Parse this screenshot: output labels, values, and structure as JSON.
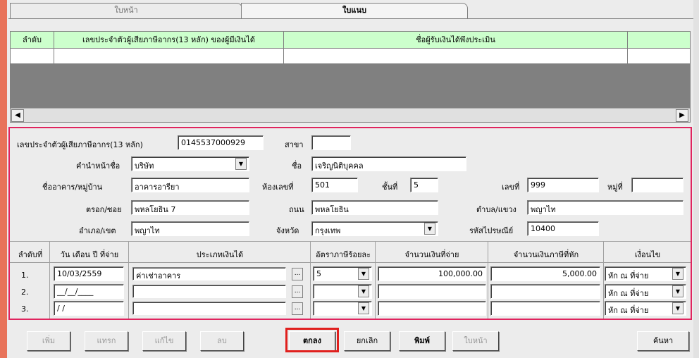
{
  "tabs": {
    "front": "ใบหน้า",
    "form": "ใบแนบ"
  },
  "grid": {
    "headers": [
      "ลำดับ",
      "เลขประจำตัวผู้เสียภาษีอากร(13 หลัก) ของผู้มีเงินได้",
      "ชื่อผู้รับเงินได้พึงประเมิน"
    ],
    "scroll_left": "◀",
    "scroll_right": "▶"
  },
  "form": {
    "taxid_label": "เลขประจำตัวผู้เสียภาษีอากร(13 หลัก)",
    "taxid_value": "0145537000929",
    "branch_label": "สาขา",
    "branch_value": "",
    "prefix_label": "คำนำหน้าชื่อ",
    "prefix_value": "บริษัท",
    "name_label": "ชื่อ",
    "name_value": "เจริญนิติบุคคล",
    "building_label": "ชื่ออาคาร/หมู่บ้าน",
    "building_value": "อาคารอารียา",
    "room_label": "ห้องเลขที่",
    "room_value": "501",
    "floor_label": "ชั้นที่",
    "floor_value": "5",
    "houseno_label": "เลขที่",
    "houseno_value": "999",
    "moo_label": "หมู่ที่",
    "moo_value": "",
    "soi_label": "ตรอก/ซอย",
    "soi_value": "พหลโยธิน 7",
    "road_label": "ถนน",
    "road_value": "พหลโยธิน",
    "subdistrict_label": "ตำบล/แขวง",
    "subdistrict_value": "พญาไท",
    "district_label": "อำเภอ/เขต",
    "district_value": "พญาไท",
    "province_label": "จังหวัด",
    "province_value": "กรุงเทพ",
    "postcode_label": "รหัสไปรษณีย์",
    "postcode_value": "10400"
  },
  "items": {
    "headers": {
      "no": "ลำดับที่",
      "date": "วัน เดือน ปี ที่จ่าย",
      "type": "ประเภทเงินได้",
      "rate": "อัตราภาษีร้อยละ",
      "paid": "จำนวนเงินที่จ่าย",
      "tax": "จำนวนเงินภาษีที่หัก",
      "cond": "เงื่อนไข"
    },
    "rows": [
      {
        "no": "1.",
        "date": "10/03/2559",
        "type": "ค่าเช่าอาคาร",
        "rate": "5",
        "paid": "100,000.00",
        "tax": "5,000.00",
        "cond": "หัก ณ ที่จ่าย"
      },
      {
        "no": "2.",
        "date": "__/__/____",
        "type": "",
        "rate": "",
        "paid": "",
        "tax": "",
        "cond": "หัก ณ ที่จ่าย"
      },
      {
        "no": "3.",
        "date": "/ /",
        "type": "",
        "rate": "",
        "paid": "",
        "tax": "",
        "cond": "หัก ณ ที่จ่าย"
      }
    ]
  },
  "buttons": {
    "add": "เพิ่ม",
    "insert": "แทรก",
    "edit": "แก้ไข",
    "delete": "ลบ",
    "ok": "ตกลง",
    "cancel": "ยกเลิก",
    "print": "พิมพ์",
    "front": "ใบหน้า",
    "search": "ค้นหา"
  }
}
